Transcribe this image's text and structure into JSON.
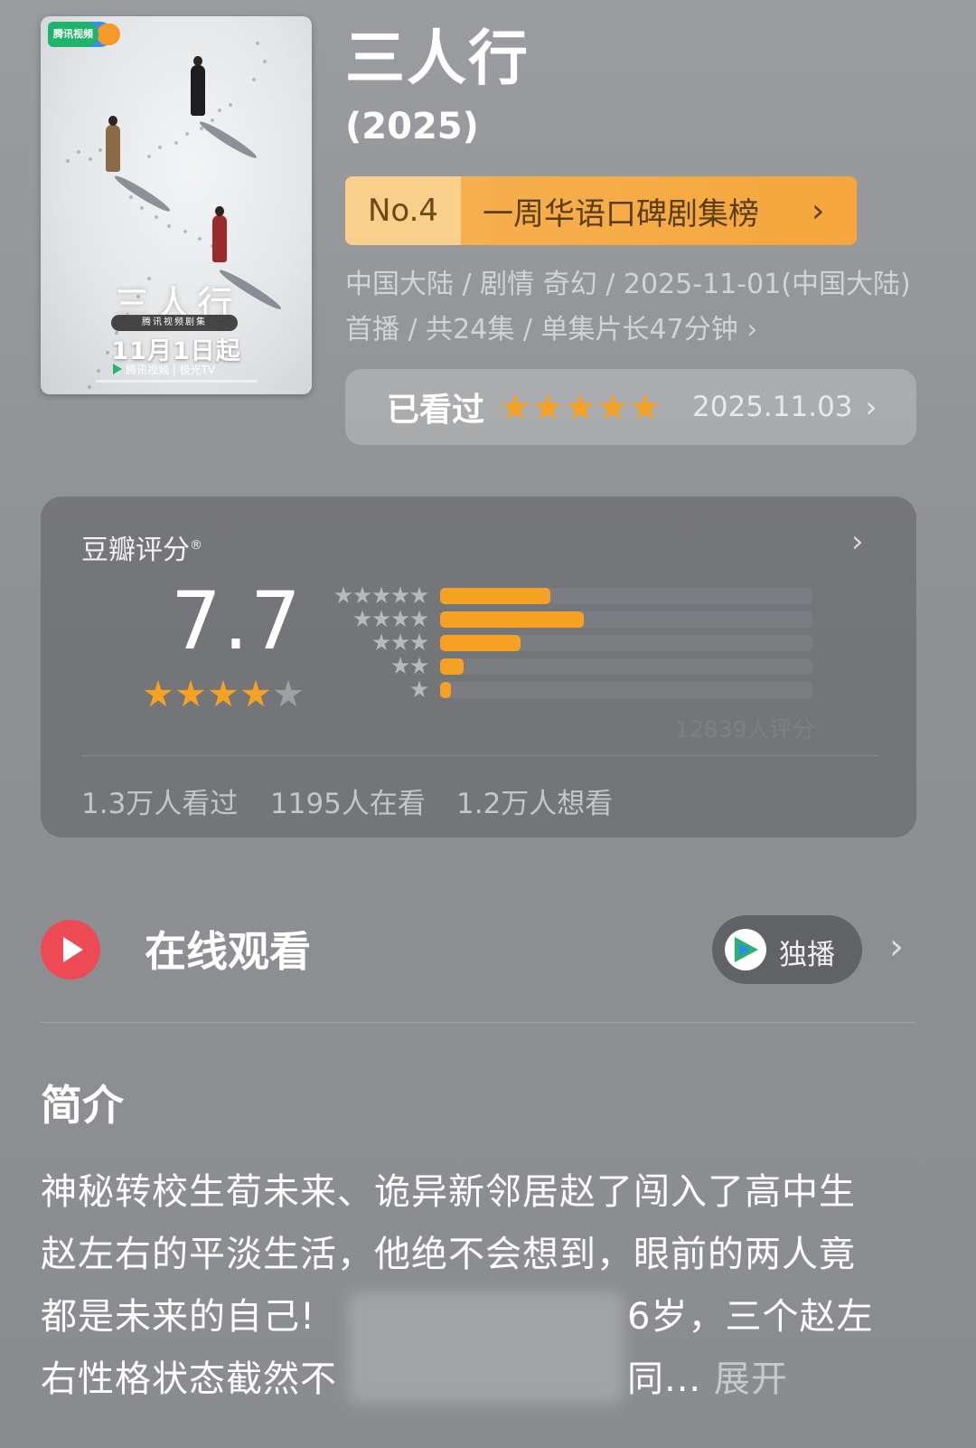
{
  "poster": {
    "platform_logo_text": "腾讯视频",
    "title_art": "三人行",
    "tag": "腾讯视频剧集",
    "premiere": "11月1日起",
    "brand": "腾讯视频 | 极光TV"
  },
  "title": "三人行",
  "year": "(2025)",
  "rank": {
    "number": "No.4",
    "label": "一周华语口碑剧集榜",
    "chevron": "›"
  },
  "meta": {
    "text": "中国大陆 / 剧情 奇幻 / 2025-11-01(中国大陆)首播 / 共24集 / 单集片长47分钟",
    "chevron": "›"
  },
  "user_rating": {
    "label": "已看过",
    "stars": 5,
    "max_stars": 5,
    "date": "2025.11.03",
    "chevron": "›"
  },
  "douban": {
    "title": "豆瓣评分",
    "mark": "®",
    "score": "7.7",
    "score_stars": 4,
    "max_stars": 5,
    "distribution": [
      {
        "stars": 5,
        "percent": 29.6
      },
      {
        "stars": 4,
        "percent": 38.6
      },
      {
        "stars": 3,
        "percent": 21.7
      },
      {
        "stars": 2,
        "percent": 6.3
      },
      {
        "stars": 1,
        "percent": 2.9
      }
    ],
    "count_text": "12839人评分",
    "stats": [
      "1.3万人看过",
      "1195人在看",
      "1.2万人想看"
    ],
    "chevron": "›"
  },
  "watch": {
    "title": "在线观看",
    "source_label": "独播",
    "chevron": "›",
    "accent": "#ee4a55"
  },
  "intro": {
    "title": "简介",
    "lines": [
      "神秘转校生荀未来、诡异新邻居赵了闯入了高中生",
      "赵左右的平淡生活，他绝不会想到，眼前的两人竟",
      "都是未来的自己!",
      "6岁，三个赵左",
      "右性格状态截然不",
      "同..."
    ],
    "expand": "展开"
  },
  "colors": {
    "star": "#f5a123",
    "rank_bg": "#f6a63c",
    "bar": "#f5a124"
  }
}
